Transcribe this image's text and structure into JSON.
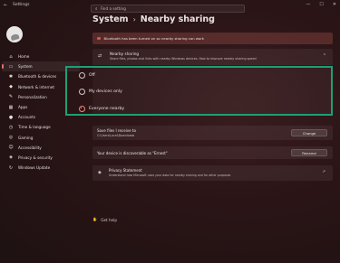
{
  "window": {
    "title": "Settings",
    "controls": [
      "—",
      "☐",
      "✕"
    ]
  },
  "search": {
    "placeholder": "Find a setting"
  },
  "breadcrumb": {
    "parent": "System",
    "separator": "›",
    "current": "Nearby sharing"
  },
  "sidebar": {
    "items": [
      {
        "label": "Home",
        "icon": "home-icon",
        "glyph": "⌂"
      },
      {
        "label": "System",
        "icon": "system-icon",
        "glyph": "▭",
        "selected": true
      },
      {
        "label": "Bluetooth & devices",
        "icon": "bluetooth-icon",
        "glyph": "✱"
      },
      {
        "label": "Network & internet",
        "icon": "network-icon",
        "glyph": "◆"
      },
      {
        "label": "Personalization",
        "icon": "brush-icon",
        "glyph": "✎"
      },
      {
        "label": "Apps",
        "icon": "apps-icon",
        "glyph": "▦"
      },
      {
        "label": "Accounts",
        "icon": "accounts-icon",
        "glyph": "●"
      },
      {
        "label": "Time & language",
        "icon": "time-icon",
        "glyph": "◷"
      },
      {
        "label": "Gaming",
        "icon": "gaming-icon",
        "glyph": "◎"
      },
      {
        "label": "Accessibility",
        "icon": "accessibility-icon",
        "glyph": "☺"
      },
      {
        "label": "Privacy & security",
        "icon": "shield-icon",
        "glyph": "◈"
      },
      {
        "label": "Windows Update",
        "icon": "update-icon",
        "glyph": "↻"
      }
    ]
  },
  "notice": {
    "text": "Bluetooth has been turned on so nearby sharing can work"
  },
  "nearby_sharing": {
    "title": "Nearby sharing",
    "subtitle": "Share files, photos and links with nearby Windows devices. How to improve nearby sharing speed",
    "options": [
      {
        "label": "Off",
        "selected": false
      },
      {
        "label": "My devices only",
        "selected": false
      },
      {
        "label": "Everyone nearby",
        "selected": true
      }
    ]
  },
  "save_files": {
    "title": "Save files I receive to",
    "path": "C:\\Users\\Local\\Downloads",
    "button": "Change"
  },
  "discoverable": {
    "title": "Your device is discoverable as \"Ernest\"",
    "button": "Rename"
  },
  "privacy": {
    "title": "Privacy Statement",
    "subtitle": "Understand how Microsoft uses your data for nearby sharing and for other purposes"
  },
  "help": {
    "label": "Get help"
  },
  "colors": {
    "accent": "#f08a78",
    "highlight": "#1e9e77",
    "notice_dot": "#d65a4a"
  }
}
